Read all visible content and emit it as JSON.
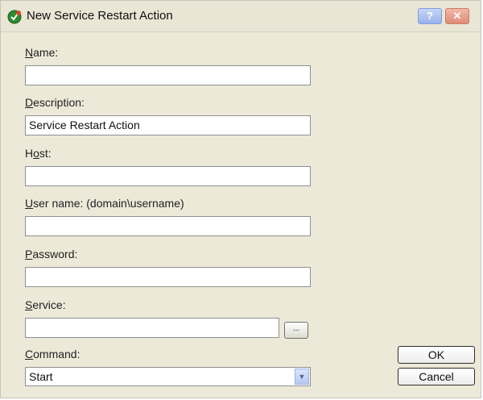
{
  "dialog": {
    "title": "New Service Restart Action",
    "help_button": "?",
    "close_button": "✕"
  },
  "fields": {
    "name": {
      "label_mnemonic": "N",
      "label_rest": "ame:",
      "value": ""
    },
    "description": {
      "label_mnemonic": "D",
      "label_rest": "escription:",
      "value": "Service Restart Action"
    },
    "host": {
      "label_prefix": "H",
      "label_mnemonic": "o",
      "label_rest": "st:",
      "value": ""
    },
    "username": {
      "label_mnemonic": "U",
      "label_rest": "ser name: (domain\\username)",
      "value": ""
    },
    "password": {
      "label_mnemonic": "P",
      "label_rest": "assword:",
      "value": ""
    },
    "service": {
      "label_mnemonic": "S",
      "label_rest": "ervice:",
      "value": "",
      "browse_label": "..."
    },
    "command": {
      "label_mnemonic": "C",
      "label_rest": "ommand:",
      "selected": "Start"
    }
  },
  "buttons": {
    "ok": "OK",
    "cancel": "Cancel"
  }
}
